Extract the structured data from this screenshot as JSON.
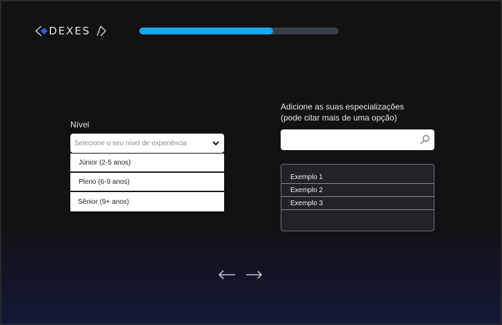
{
  "app": {
    "logo_text": "DEXES"
  },
  "progress": {
    "percent": 67
  },
  "nivel": {
    "label": "Nível",
    "placeholder": "Selecione o seu nível de experiência",
    "options": [
      "Júnior (2-5 anos)",
      "Pleno (6-9 anos)",
      "Sênior (9+ anos)"
    ]
  },
  "specializations": {
    "label_line1": "Adicione as suas especializações",
    "label_line2": "(pode citar mais de uma opção)",
    "search_value": "",
    "items": [
      "Exemplo 1",
      "Exemplo 2",
      "Exemplo 3"
    ]
  },
  "navigation": {
    "back_icon": "arrow-left-icon",
    "next_icon": "arrow-right-icon"
  },
  "colors": {
    "accent": "#1aa8ea",
    "track": "#3b3f47",
    "logo_diamond": "#2f5bd8"
  }
}
